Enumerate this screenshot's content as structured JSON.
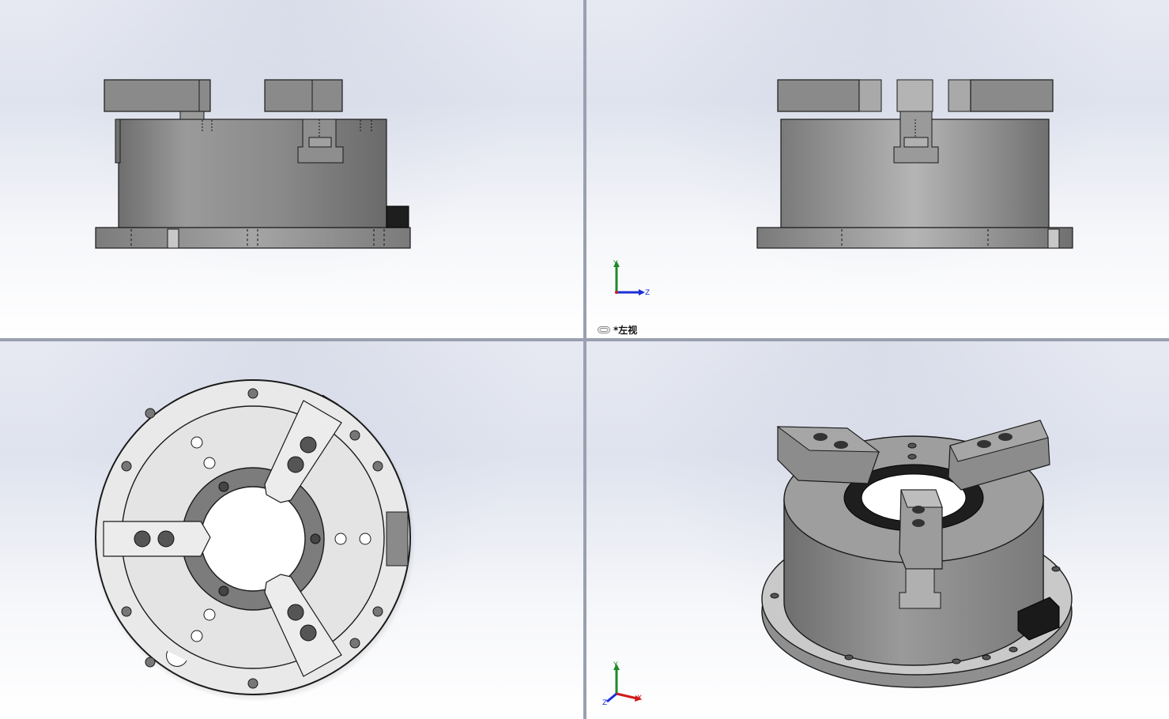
{
  "viewports": {
    "top_left": {
      "name": "front-view"
    },
    "top_right": {
      "name": "left-view",
      "label": "*左视",
      "label_icon": "link-icon",
      "triad": {
        "up": "Y",
        "right": "Z"
      }
    },
    "bottom_left": {
      "name": "top-view"
    },
    "bottom_right": {
      "name": "isometric-view",
      "triad": {
        "up": "Y",
        "right": "X",
        "down_left": "Z"
      }
    }
  },
  "colors": {
    "part_gray": "#8c8c8c",
    "part_light": "#bdbdbd",
    "part_dark": "#5a5a5a",
    "edge": "#1a1a1a",
    "axis_x": "#d11a1a",
    "axis_y": "#1f8a2a",
    "axis_z": "#1c2fd6",
    "divider": "#8e95a8"
  }
}
